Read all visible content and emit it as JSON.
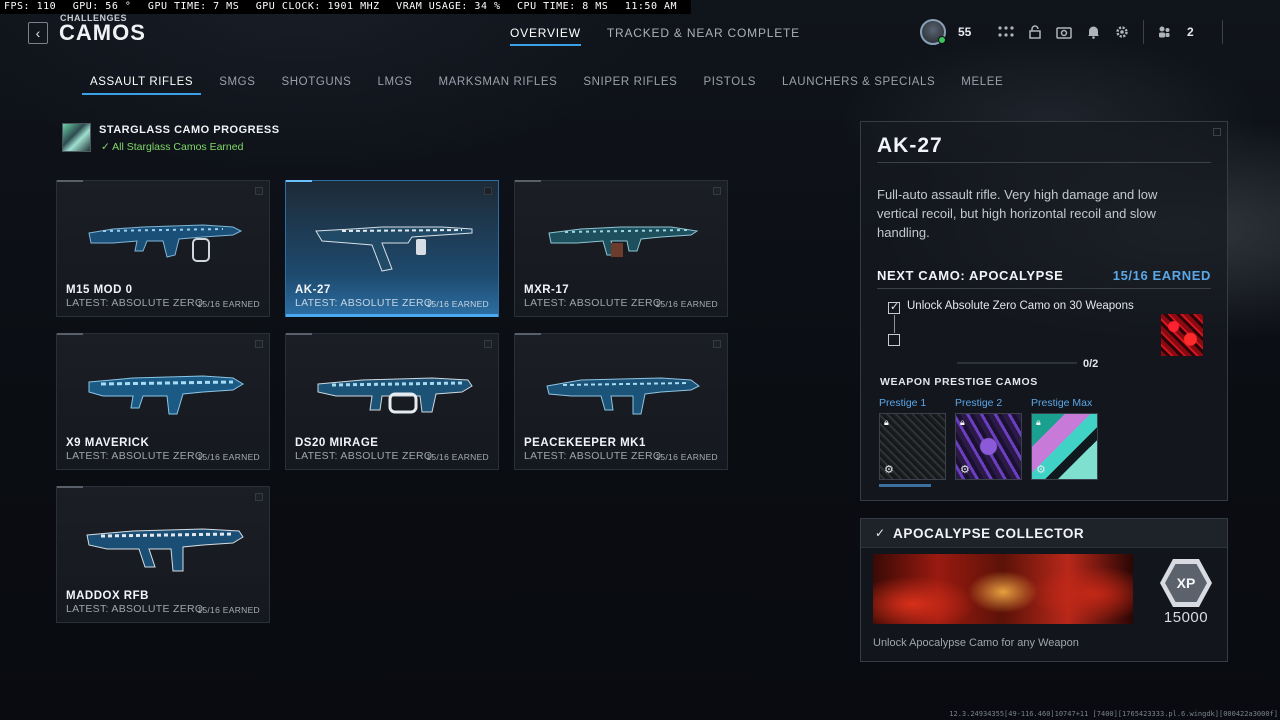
{
  "perf": {
    "fps": "FPS: 110",
    "gpu": "GPU: 56 °",
    "gpu_time": "GPU TIME: 7 MS",
    "gpu_clock": "GPU CLOCK: 1901 MHZ",
    "vram": "VRAM USAGE: 34 %",
    "cpu_time": "CPU TIME: 8 MS",
    "clock": "11:50 AM"
  },
  "header": {
    "breadcrumb": "CHALLENGES",
    "title": "CAMOS",
    "back_icon": "chevron-left-icon",
    "tabs": [
      {
        "label": "OVERVIEW",
        "active": true
      },
      {
        "label": "TRACKED & NEAR COMPLETE",
        "active": false
      }
    ],
    "player_level": "55",
    "friends_count": "2"
  },
  "categories": [
    {
      "label": "ASSAULT RIFLES",
      "active": true
    },
    {
      "label": "SMGS",
      "active": false
    },
    {
      "label": "SHOTGUNS",
      "active": false
    },
    {
      "label": "LMGS",
      "active": false
    },
    {
      "label": "MARKSMAN RIFLES",
      "active": false
    },
    {
      "label": "SNIPER RIFLES",
      "active": false
    },
    {
      "label": "PISTOLS",
      "active": false
    },
    {
      "label": "LAUNCHERS & SPECIALS",
      "active": false
    },
    {
      "label": "MELEE",
      "active": false
    }
  ],
  "starglass": {
    "title": "STARGLASS CAMO PROGRESS",
    "status": "All Starglass Camos Earned",
    "status_color": "#7fd86a"
  },
  "weapons": [
    {
      "name": "M15 MOD 0",
      "latest": "LATEST: ABSOLUTE ZERO",
      "earned": "15/16 EARNED",
      "selected": false
    },
    {
      "name": "AK-27",
      "latest": "LATEST: ABSOLUTE ZERO",
      "earned": "15/16 EARNED",
      "selected": true
    },
    {
      "name": "MXR-17",
      "latest": "LATEST: ABSOLUTE ZERO",
      "earned": "15/16 EARNED",
      "selected": false
    },
    {
      "name": "X9 MAVERICK",
      "latest": "LATEST: ABSOLUTE ZERO",
      "earned": "15/16 EARNED",
      "selected": false
    },
    {
      "name": "DS20 MIRAGE",
      "latest": "LATEST: ABSOLUTE ZERO",
      "earned": "15/16 EARNED",
      "selected": false
    },
    {
      "name": "PEACEKEEPER MK1",
      "latest": "LATEST: ABSOLUTE ZERO",
      "earned": "15/16 EARNED",
      "selected": false
    },
    {
      "name": "MADDOX RFB",
      "latest": "LATEST: ABSOLUTE ZERO",
      "earned": "15/16 EARNED",
      "selected": false
    }
  ],
  "detail": {
    "name": "AK-27",
    "description": "Full-auto assault rifle. Very high damage and low vertical recoil, but high horizontal recoil and slow handling.",
    "next_camo": "NEXT CAMO: APOCALYPSE",
    "earned": "15/16 EARNED",
    "task": "Unlock Absolute Zero Camo on 30 Weapons",
    "task_checked": true,
    "second_checked": false,
    "count": "0/2",
    "prestige_title": "WEAPON PRESTIGE CAMOS",
    "prestige": [
      {
        "label": "Prestige 1"
      },
      {
        "label": "Prestige 2"
      },
      {
        "label": "Prestige Max"
      }
    ]
  },
  "collector": {
    "title": "APOCALYPSE COLLECTOR",
    "xp_label": "XP",
    "xp_amount": "15000",
    "description": "Unlock Apocalypse Camo for any Weapon"
  },
  "build": "12.3.24934355[49-116.460]10747+11 [7400][1765423333.pl.6.wingdk][000422a3000f]",
  "colors": {
    "accent": "#3aa0e8",
    "earned_blue": "#5aa7e8",
    "success_green": "#7fd86a"
  }
}
